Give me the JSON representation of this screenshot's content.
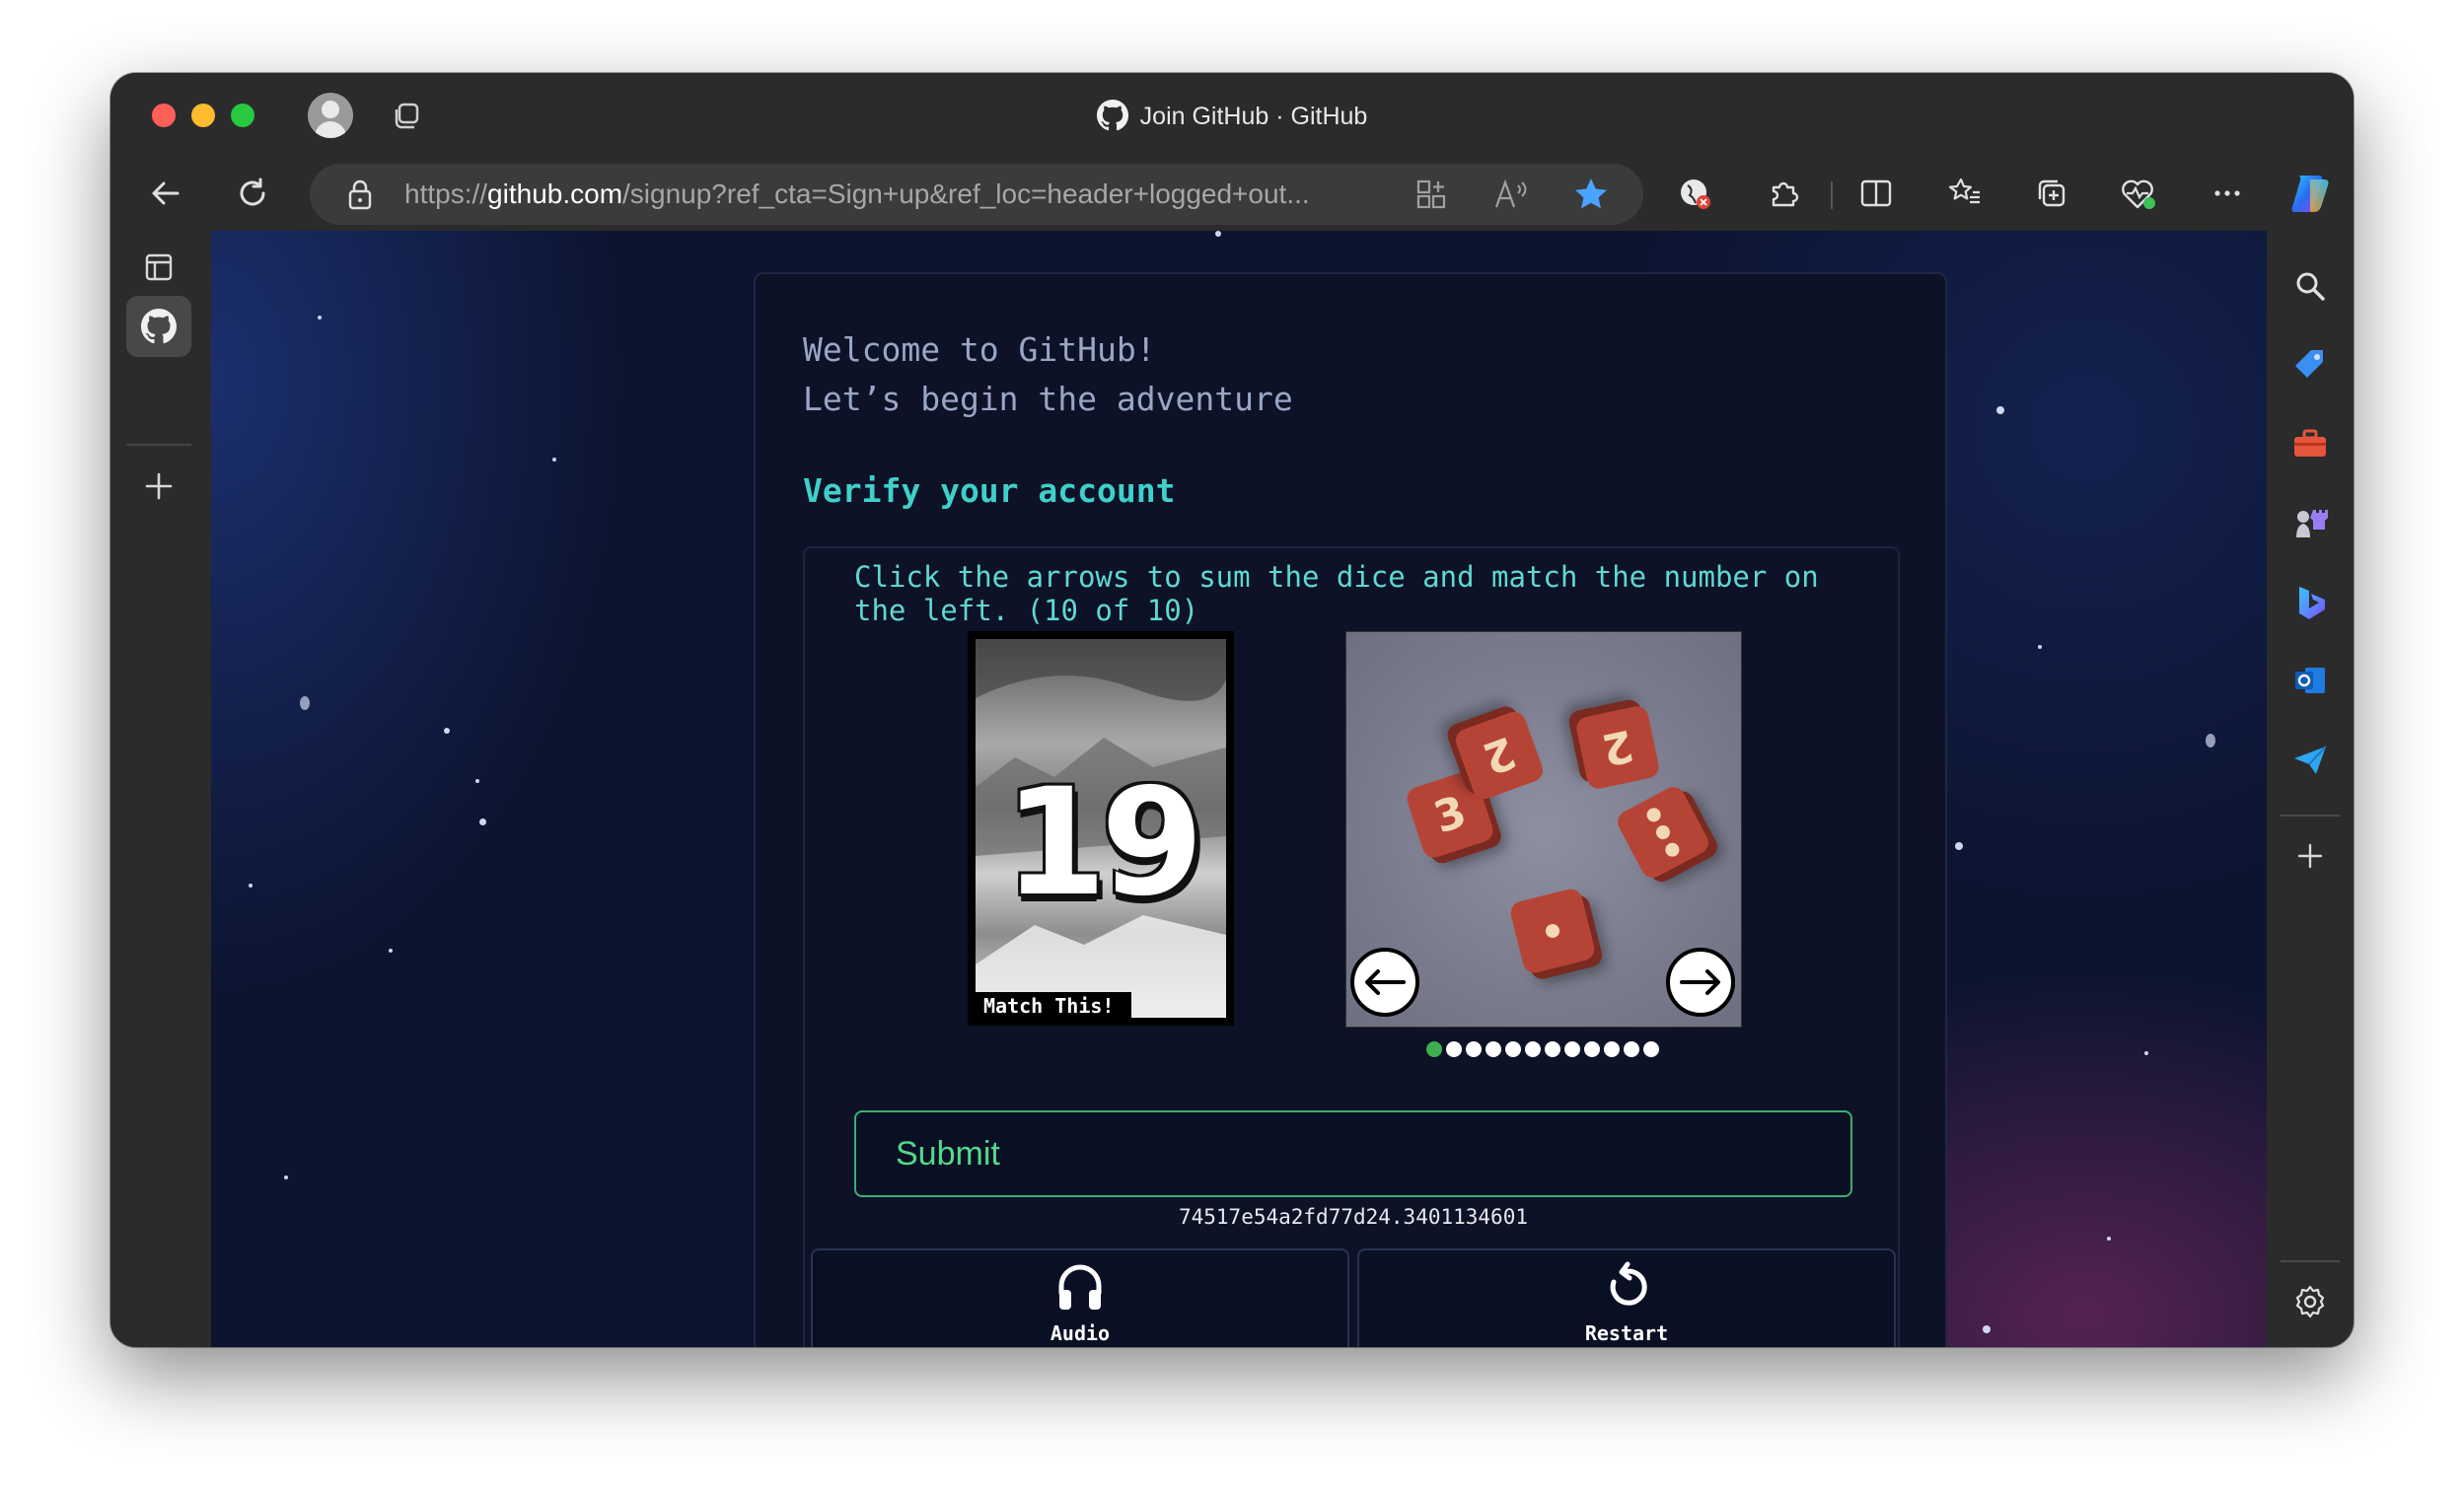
{
  "browser": {
    "tab_title": "Join GitHub · GitHub",
    "url_prefix": "https://",
    "url_host": "github.com",
    "url_path": "/signup?ref_cta=Sign+up&ref_loc=header+logged+out..."
  },
  "icons": {
    "titlebar": [
      "profile-avatar",
      "tabs-icon",
      "github-icon"
    ],
    "nav": [
      "back-arrow-icon",
      "refresh-icon",
      "lock-icon",
      "split-screen-icon",
      "read-aloud-icon",
      "favorite-star-icon",
      "extension-icon",
      "puzzle-icon",
      "split-view-icon",
      "favorites-icon",
      "collections-icon",
      "health-icon",
      "more-icon",
      "copilot-icon"
    ],
    "left_rail": [
      "sidebar-toggle-icon",
      "github-tab-icon",
      "add-tab-icon"
    ],
    "right_rail": [
      "search-icon",
      "shopping-tag-icon",
      "toolbox-icon",
      "games-icon",
      "bing-icon",
      "outlook-icon",
      "send-icon",
      "add-icon",
      "settings-icon"
    ]
  },
  "page": {
    "welcome_line1": "Welcome to GitHub!",
    "welcome_line2": "Let’s begin the adventure",
    "verify_heading": "Verify your account",
    "instructions": "Click the arrows to sum the dice and match the number on the left. (10 of 10)",
    "target_number": "19",
    "match_label": "Match This!",
    "dice_faces": [
      "3",
      "2",
      "2",
      "3",
      "1"
    ],
    "carousel_count": 12,
    "carousel_current": 0,
    "submit_label": "Submit",
    "session_id": "74517e54a2fd77d24.3401134601",
    "audio_label": "Audio",
    "restart_label": "Restart"
  },
  "colors": {
    "accent_teal": "#3fd0c9",
    "submit_green": "#55d88a",
    "die_red": "#b64436"
  }
}
